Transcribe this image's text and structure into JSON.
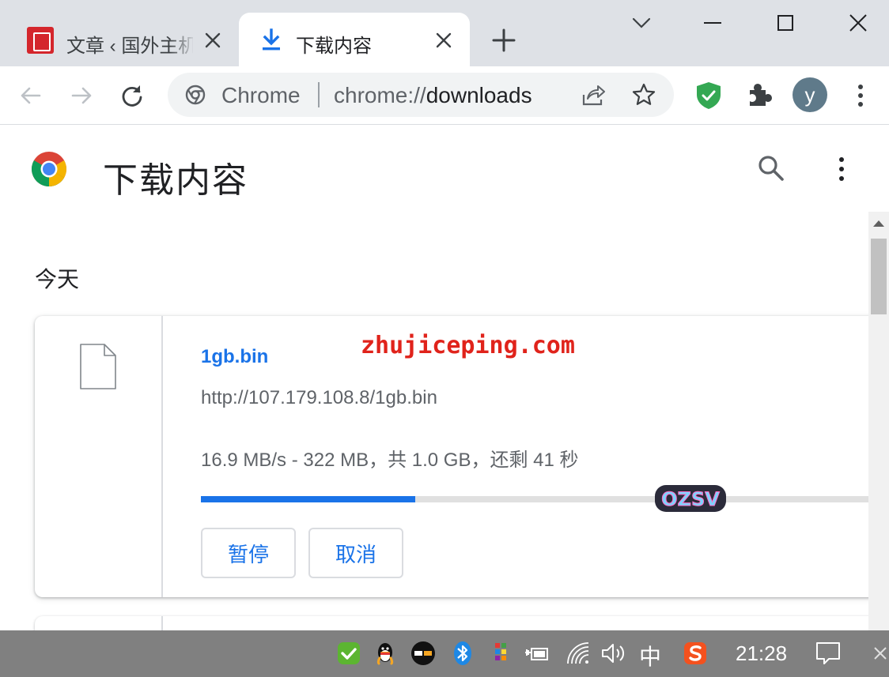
{
  "tabs": [
    {
      "title": "文章 ‹ 国外主机测评",
      "active": false,
      "favicon": "site-logo-icon"
    },
    {
      "title": "下载内容",
      "active": true,
      "favicon": "download-icon"
    }
  ],
  "omnibox": {
    "scheme_label": "Chrome",
    "url_scheme": "chrome://",
    "url_path": "downloads"
  },
  "profile": {
    "initial": "y",
    "color": "#5f7a8a"
  },
  "page": {
    "title": "下载内容"
  },
  "downloads": {
    "section_date": "今天",
    "items": [
      {
        "file_name": "1gb.bin",
        "url": "http://107.179.108.8/1gb.bin",
        "status": "16.9 MB/s - 322 MB，共 1.0 GB，还剩 41 秒",
        "progress": 0.315,
        "pause_label": "暂停",
        "cancel_label": "取消"
      }
    ]
  },
  "watermark": {
    "text": "zhujiceping.com",
    "sticker_text": "OZSV"
  },
  "taskbar": {
    "ime_label": "中",
    "time": "21:28"
  },
  "colors": {
    "accent": "#1a73e8",
    "tabstrip": "#dee1e6",
    "watermark": "#e0231b",
    "taskbar": "#6e6e6e"
  }
}
